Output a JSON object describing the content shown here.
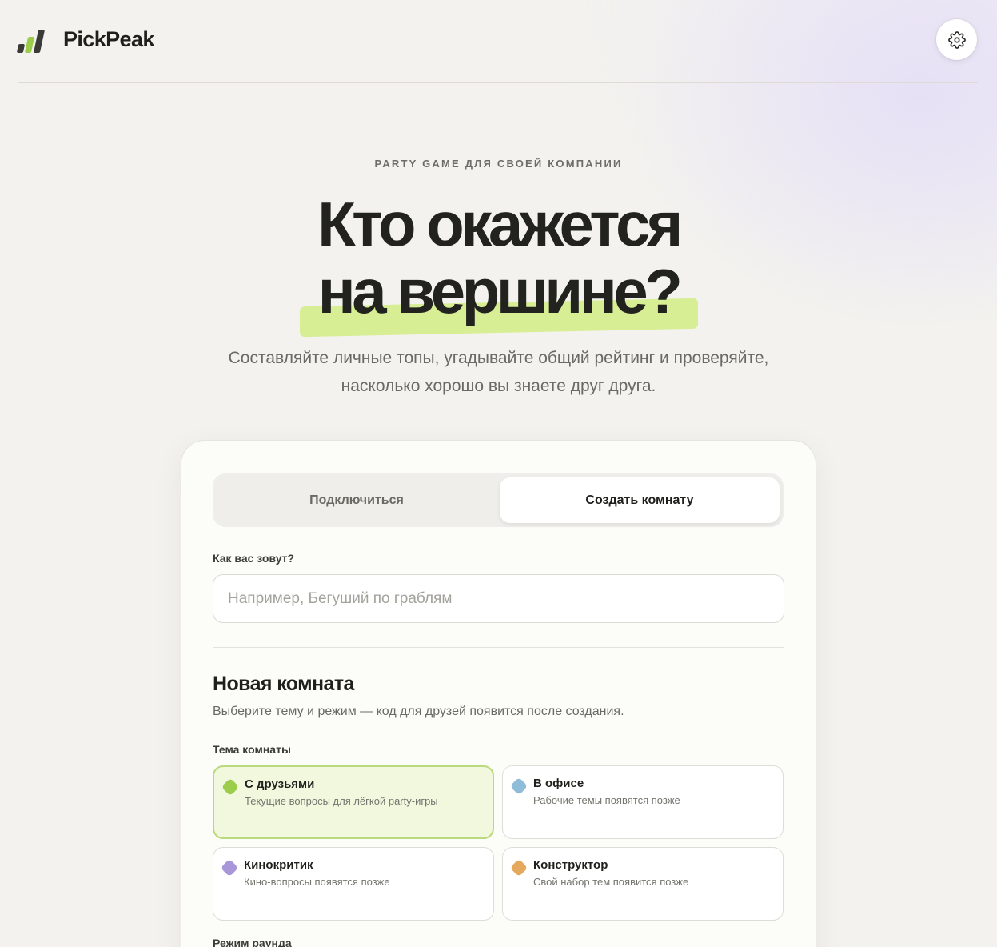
{
  "header": {
    "brand": "PickPeak",
    "settings_icon": "gear-icon"
  },
  "hero": {
    "eyebrow": "PARTY GAME ДЛЯ СВОЕЙ КОМПАНИИ",
    "title_line1": "Кто окажется",
    "title_line2": "на вершине?",
    "subtitle_line1": "Составляйте личные топы, угадывайте общий рейтинг и проверяйте,",
    "subtitle_line2": "насколько хорошо вы знаете друг друга."
  },
  "tabs": [
    {
      "label": "Подключиться",
      "active": false
    },
    {
      "label": "Создать комнату",
      "active": true
    }
  ],
  "form": {
    "name_label": "Как вас зовут?",
    "name_value": "",
    "name_placeholder": "Например, Бегуший по граблям"
  },
  "room": {
    "title": "Новая комната",
    "subtitle": "Выберите тему и режим — код для друзей появится после создания.",
    "theme_label": "Тема комнаты",
    "themes": [
      {
        "name": "С друзьями",
        "desc": "Текущие вопросы для лёгкой party-игры",
        "color": "#9ccd4a",
        "selected": true
      },
      {
        "name": "В офисе",
        "desc": "Рабочие темы появятся позже",
        "color": "#8fbcd8",
        "selected": false
      },
      {
        "name": "Кинокритик",
        "desc": "Кино-вопросы появятся позже",
        "color": "#a896d9",
        "selected": false
      },
      {
        "name": "Конструктор",
        "desc": "Свой набор тем появится позже",
        "color": "#e5a95e",
        "selected": false
      }
    ],
    "mode_label": "Режим раунда"
  },
  "colors": {
    "accent": "#d7ee95",
    "brand_green": "#9ccd4a",
    "background": "#f3f2ee"
  }
}
